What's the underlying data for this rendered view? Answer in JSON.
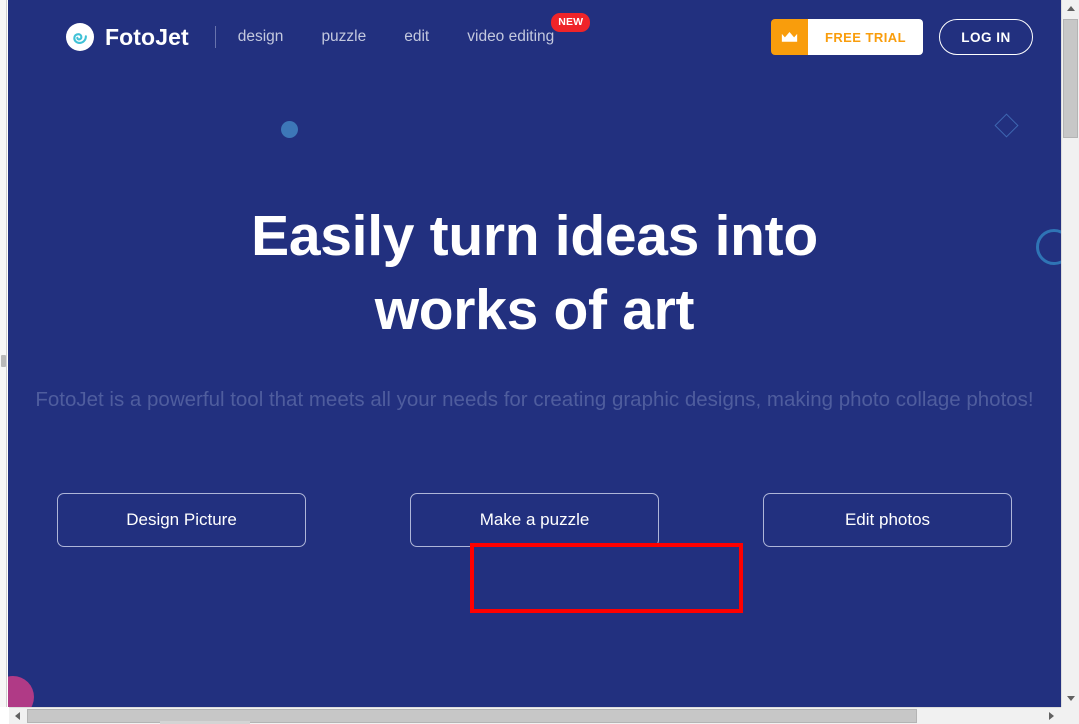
{
  "colors": {
    "page_background": "#22307f",
    "accent_orange": "#f99d0c",
    "badge_red": "#ef2429",
    "highlight_red": "#fe0000",
    "logo_teal": "#3fc1d6",
    "nav_text": "#c3c8de",
    "subtitle_text": "#4f5d9e"
  },
  "header": {
    "brand": {
      "name": "FotoJet",
      "mark_icon": "fotojet-spiral-icon"
    },
    "nav": [
      {
        "label": "design",
        "badge": null
      },
      {
        "label": "puzzle",
        "badge": null
      },
      {
        "label": "edit",
        "badge": null
      },
      {
        "label": "video editing",
        "badge": "NEW"
      }
    ],
    "actions": {
      "free_trial": {
        "label": "FREE TRIAL",
        "icon": "crown-icon"
      },
      "login_label": "LOG IN"
    }
  },
  "hero": {
    "title": "Easily turn ideas into works of art",
    "subtitle": "FotoJet is a powerful tool that meets all your needs for creating graphic designs, making photo collage photos!",
    "buttons": [
      {
        "label": "Design Picture",
        "highlighted": false
      },
      {
        "label": "Make a puzzle",
        "highlighted": true
      },
      {
        "label": "Edit photos",
        "highlighted": false
      }
    ]
  },
  "decorations": [
    {
      "name": "filled-dot",
      "shape": "circle"
    },
    {
      "name": "diamond-outline",
      "shape": "diamond"
    },
    {
      "name": "ring-outline",
      "shape": "ring"
    },
    {
      "name": "corner-blob",
      "shape": "circle"
    }
  ],
  "scrollbars": {
    "vertical": {
      "position": "right",
      "thumb_at_top": true
    },
    "horizontal": {
      "position": "bottom",
      "thumb_at_left": true
    }
  }
}
